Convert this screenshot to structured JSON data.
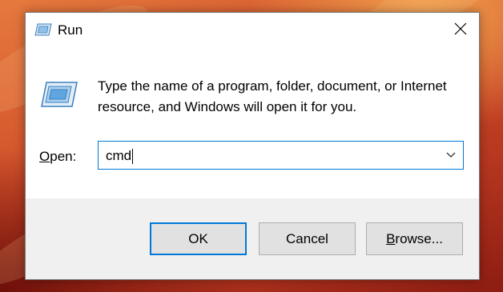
{
  "window": {
    "title": "Run",
    "title_icon": "run-icon",
    "close_icon": "close-icon"
  },
  "content": {
    "icon": "run-icon",
    "description": "Type the name of a program, folder, document, or Internet resource, and Windows will open it for you."
  },
  "open_field": {
    "label_mnemonic": "O",
    "label_rest": "pen:",
    "value": "cmd",
    "dropdown_icon": "chevron-down-icon"
  },
  "buttons": {
    "ok": "OK",
    "cancel": "Cancel",
    "browse_mnemonic": "B",
    "browse_rest": "rowse..."
  },
  "colors": {
    "accent": "#0078d7",
    "footer_bg": "#f0f0f0",
    "button_bg": "#e1e1e1"
  }
}
